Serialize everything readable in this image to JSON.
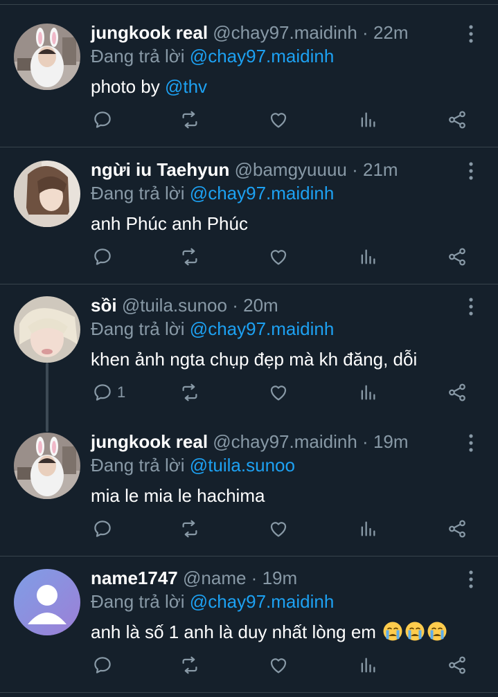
{
  "reply_prefix": "Đang trả lời",
  "tweets": [
    {
      "name": "jungkook real",
      "handle": "@chay97.maidinh",
      "time": "22m",
      "reply_to": "@chay97.maidinh",
      "body_text": "photo by ",
      "body_mention": "@thv",
      "reply_count": ""
    },
    {
      "name": "ngừi iu Taehyun",
      "handle": "@bamgyuuuu",
      "time": "21m",
      "reply_to": "@chay97.maidinh",
      "body_text": "anh Phúc anh Phúc",
      "reply_count": ""
    },
    {
      "name": "sồi",
      "handle": "@tuila.sunoo",
      "time": "20m",
      "reply_to": "@chay97.maidinh",
      "body_text": "khen ảnh ngta chụp đẹp mà kh đăng, dỗi",
      "reply_count": "1"
    },
    {
      "name": "jungkook real",
      "handle": "@chay97.maidinh",
      "time": "19m",
      "reply_to": "@tuila.sunoo",
      "body_text": "mia le mia le hachima",
      "reply_count": ""
    },
    {
      "name": "name1747",
      "handle": "@name",
      "time": "19m",
      "reply_to": "@chay97.maidinh",
      "body_text": "anh là số 1 anh là duy nhất lòng em ",
      "reply_count": ""
    }
  ],
  "colors": {
    "background": "#15202b",
    "divider": "#38444d",
    "muted": "#8899a6",
    "link": "#1da1f2"
  },
  "icons": [
    "reply-icon",
    "retweet-icon",
    "like-icon",
    "analytics-icon",
    "share-icon",
    "more-icon",
    "crying-emoji-icon"
  ]
}
